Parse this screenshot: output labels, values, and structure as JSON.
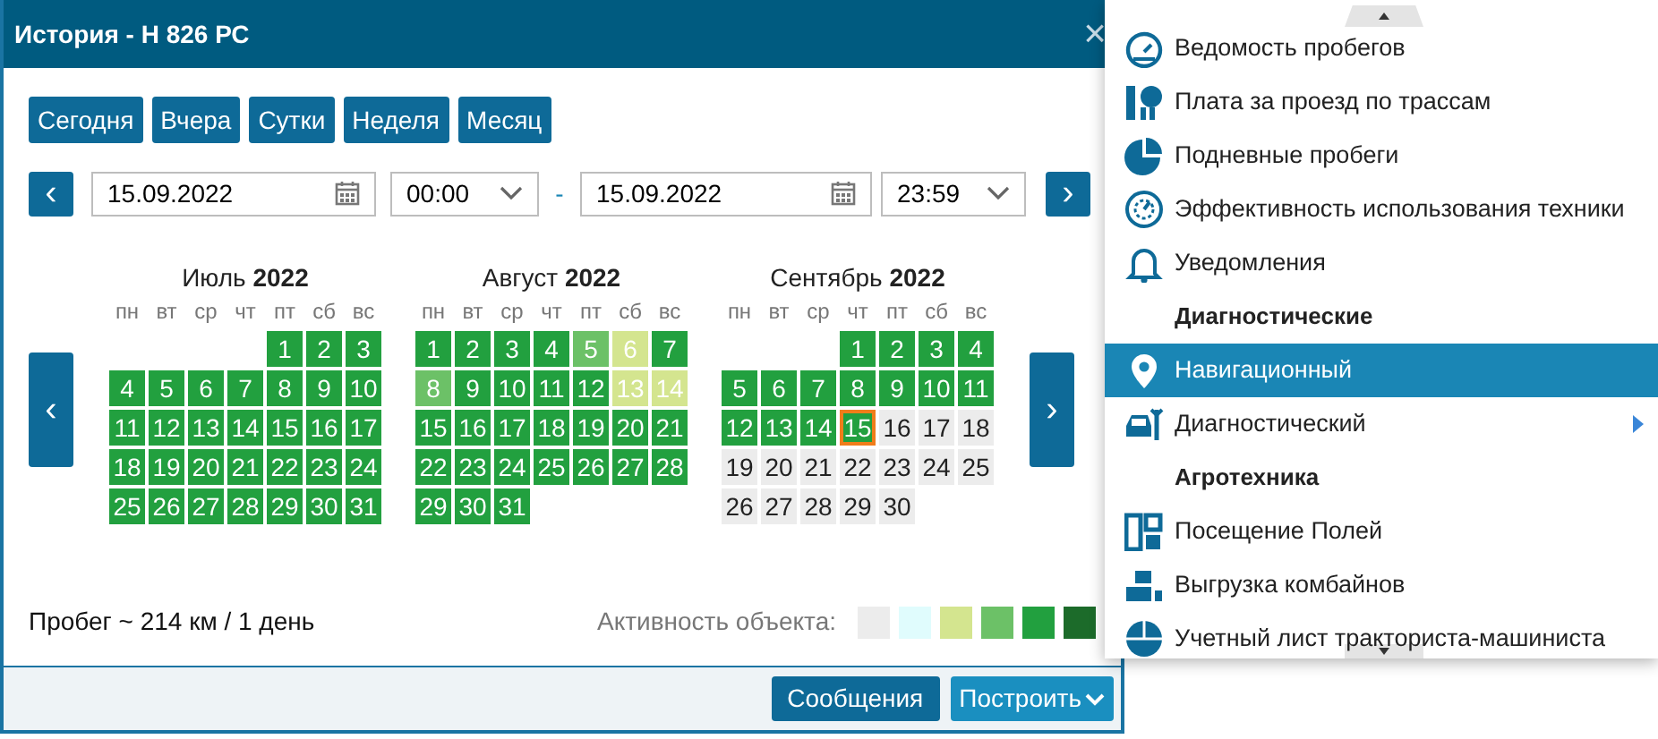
{
  "window": {
    "title": "История - Н 826 РС",
    "close": "×"
  },
  "quick_buttons": [
    "Сегодня",
    "Вчера",
    "Сутки",
    "Неделя",
    "Месяц"
  ],
  "range": {
    "prev": "‹",
    "from_date": "15.09.2022",
    "from_time": "00:00",
    "separator": "-",
    "to_date": "15.09.2022",
    "to_time": "23:59",
    "next": "›"
  },
  "calendar": {
    "prev": "‹",
    "next": "›",
    "months": [
      {
        "name": "Июль",
        "year": "2022",
        "weekdays": [
          "пн",
          "вт",
          "ср",
          "чт",
          "пт",
          "сб",
          "вс"
        ],
        "weeks": [
          [
            {
              "kind": "blank"
            },
            {
              "kind": "blank"
            },
            {
              "kind": "blank"
            },
            {
              "kind": "blank"
            },
            {
              "kind": "day",
              "day": "1",
              "color": "#22a03f",
              "selected": false
            },
            {
              "kind": "day",
              "day": "2",
              "color": "#22a03f",
              "selected": false
            },
            {
              "kind": "day",
              "day": "3",
              "color": "#22a03f",
              "selected": false
            }
          ],
          [
            {
              "kind": "day",
              "day": "4",
              "color": "#22a03f",
              "selected": false
            },
            {
              "kind": "day",
              "day": "5",
              "color": "#22a03f",
              "selected": false
            },
            {
              "kind": "day",
              "day": "6",
              "color": "#22a03f",
              "selected": false
            },
            {
              "kind": "day",
              "day": "7",
              "color": "#22a03f",
              "selected": false
            },
            {
              "kind": "day",
              "day": "8",
              "color": "#22a03f",
              "selected": false
            },
            {
              "kind": "day",
              "day": "9",
              "color": "#22a03f",
              "selected": false
            },
            {
              "kind": "day",
              "day": "10",
              "color": "#22a03f",
              "selected": false
            }
          ],
          [
            {
              "kind": "day",
              "day": "11",
              "color": "#22a03f",
              "selected": false
            },
            {
              "kind": "day",
              "day": "12",
              "color": "#22a03f",
              "selected": false
            },
            {
              "kind": "day",
              "day": "13",
              "color": "#22a03f",
              "selected": false
            },
            {
              "kind": "day",
              "day": "14",
              "color": "#22a03f",
              "selected": false
            },
            {
              "kind": "day",
              "day": "15",
              "color": "#22a03f",
              "selected": false
            },
            {
              "kind": "day",
              "day": "16",
              "color": "#22a03f",
              "selected": false
            },
            {
              "kind": "day",
              "day": "17",
              "color": "#22a03f",
              "selected": false
            }
          ],
          [
            {
              "kind": "day",
              "day": "18",
              "color": "#22a03f",
              "selected": false
            },
            {
              "kind": "day",
              "day": "19",
              "color": "#22a03f",
              "selected": false
            },
            {
              "kind": "day",
              "day": "20",
              "color": "#22a03f",
              "selected": false
            },
            {
              "kind": "day",
              "day": "21",
              "color": "#22a03f",
              "selected": false
            },
            {
              "kind": "day",
              "day": "22",
              "color": "#22a03f",
              "selected": false
            },
            {
              "kind": "day",
              "day": "23",
              "color": "#22a03f",
              "selected": false
            },
            {
              "kind": "day",
              "day": "24",
              "color": "#22a03f",
              "selected": false
            }
          ],
          [
            {
              "kind": "day",
              "day": "25",
              "color": "#22a03f",
              "selected": false
            },
            {
              "kind": "day",
              "day": "26",
              "color": "#22a03f",
              "selected": false
            },
            {
              "kind": "day",
              "day": "27",
              "color": "#22a03f",
              "selected": false
            },
            {
              "kind": "day",
              "day": "28",
              "color": "#22a03f",
              "selected": false
            },
            {
              "kind": "day",
              "day": "29",
              "color": "#22a03f",
              "selected": false
            },
            {
              "kind": "day",
              "day": "30",
              "color": "#22a03f",
              "selected": false
            },
            {
              "kind": "day",
              "day": "31",
              "color": "#22a03f",
              "selected": false
            }
          ]
        ]
      },
      {
        "name": "Август",
        "year": "2022",
        "weekdays": [
          "пн",
          "вт",
          "ср",
          "чт",
          "пт",
          "сб",
          "вс"
        ],
        "weeks": [
          [
            {
              "kind": "day",
              "day": "1",
              "color": "#22a03f",
              "selected": false
            },
            {
              "kind": "day",
              "day": "2",
              "color": "#22a03f",
              "selected": false
            },
            {
              "kind": "day",
              "day": "3",
              "color": "#22a03f",
              "selected": false
            },
            {
              "kind": "day",
              "day": "4",
              "color": "#22a03f",
              "selected": false
            },
            {
              "kind": "day",
              "day": "5",
              "color": "#6cc167",
              "selected": false
            },
            {
              "kind": "day",
              "day": "6",
              "color": "#d4e58f",
              "selected": false
            },
            {
              "kind": "day",
              "day": "7",
              "color": "#22a03f",
              "selected": false
            }
          ],
          [
            {
              "kind": "day",
              "day": "8",
              "color": "#6cc167",
              "selected": false
            },
            {
              "kind": "day",
              "day": "9",
              "color": "#22a03f",
              "selected": false
            },
            {
              "kind": "day",
              "day": "10",
              "color": "#22a03f",
              "selected": false
            },
            {
              "kind": "day",
              "day": "11",
              "color": "#22a03f",
              "selected": false
            },
            {
              "kind": "day",
              "day": "12",
              "color": "#22a03f",
              "selected": false
            },
            {
              "kind": "day",
              "day": "13",
              "color": "#d4e58f",
              "selected": false
            },
            {
              "kind": "day",
              "day": "14",
              "color": "#d4e58f",
              "selected": false
            }
          ],
          [
            {
              "kind": "day",
              "day": "15",
              "color": "#22a03f",
              "selected": false
            },
            {
              "kind": "day",
              "day": "16",
              "color": "#22a03f",
              "selected": false
            },
            {
              "kind": "day",
              "day": "17",
              "color": "#22a03f",
              "selected": false
            },
            {
              "kind": "day",
              "day": "18",
              "color": "#22a03f",
              "selected": false
            },
            {
              "kind": "day",
              "day": "19",
              "color": "#22a03f",
              "selected": false
            },
            {
              "kind": "day",
              "day": "20",
              "color": "#22a03f",
              "selected": false
            },
            {
              "kind": "day",
              "day": "21",
              "color": "#22a03f",
              "selected": false
            }
          ],
          [
            {
              "kind": "day",
              "day": "22",
              "color": "#22a03f",
              "selected": false
            },
            {
              "kind": "day",
              "day": "23",
              "color": "#22a03f",
              "selected": false
            },
            {
              "kind": "day",
              "day": "24",
              "color": "#22a03f",
              "selected": false
            },
            {
              "kind": "day",
              "day": "25",
              "color": "#22a03f",
              "selected": false
            },
            {
              "kind": "day",
              "day": "26",
              "color": "#22a03f",
              "selected": false
            },
            {
              "kind": "day",
              "day": "27",
              "color": "#22a03f",
              "selected": false
            },
            {
              "kind": "day",
              "day": "28",
              "color": "#22a03f",
              "selected": false
            }
          ],
          [
            {
              "kind": "day",
              "day": "29",
              "color": "#22a03f",
              "selected": false
            },
            {
              "kind": "day",
              "day": "30",
              "color": "#22a03f",
              "selected": false
            },
            {
              "kind": "day",
              "day": "31",
              "color": "#22a03f",
              "selected": false
            }
          ]
        ]
      },
      {
        "name": "Сентябрь",
        "year": "2022",
        "weekdays": [
          "пн",
          "вт",
          "ср",
          "чт",
          "пт",
          "сб",
          "вс"
        ],
        "weeks": [
          [
            {
              "kind": "blank"
            },
            {
              "kind": "blank"
            },
            {
              "kind": "blank"
            },
            {
              "kind": "day",
              "day": "1",
              "color": "#22a03f",
              "selected": false
            },
            {
              "kind": "day",
              "day": "2",
              "color": "#22a03f",
              "selected": false
            },
            {
              "kind": "day",
              "day": "3",
              "color": "#22a03f",
              "selected": false
            },
            {
              "kind": "day",
              "day": "4",
              "color": "#22a03f",
              "selected": false
            }
          ],
          [
            {
              "kind": "day",
              "day": "5",
              "color": "#22a03f",
              "selected": false
            },
            {
              "kind": "day",
              "day": "6",
              "color": "#22a03f",
              "selected": false
            },
            {
              "kind": "day",
              "day": "7",
              "color": "#22a03f",
              "selected": false
            },
            {
              "kind": "day",
              "day": "8",
              "color": "#22a03f",
              "selected": false
            },
            {
              "kind": "day",
              "day": "9",
              "color": "#22a03f",
              "selected": false
            },
            {
              "kind": "day",
              "day": "10",
              "color": "#22a03f",
              "selected": false
            },
            {
              "kind": "day",
              "day": "11",
              "color": "#22a03f",
              "selected": false
            }
          ],
          [
            {
              "kind": "day",
              "day": "12",
              "color": "#22a03f",
              "selected": false
            },
            {
              "kind": "day",
              "day": "13",
              "color": "#22a03f",
              "selected": false
            },
            {
              "kind": "day",
              "day": "14",
              "color": "#22a03f",
              "selected": false
            },
            {
              "kind": "day",
              "day": "15",
              "color": "#22a03f",
              "selected": true
            },
            {
              "kind": "day",
              "day": "16",
              "color": "#ececec",
              "selected": false
            },
            {
              "kind": "day",
              "day": "17",
              "color": "#ececec",
              "selected": false
            },
            {
              "kind": "day",
              "day": "18",
              "color": "#ececec",
              "selected": false
            }
          ],
          [
            {
              "kind": "day",
              "day": "19",
              "color": "#ececec",
              "selected": false
            },
            {
              "kind": "day",
              "day": "20",
              "color": "#ececec",
              "selected": false
            },
            {
              "kind": "day",
              "day": "21",
              "color": "#ececec",
              "selected": false
            },
            {
              "kind": "day",
              "day": "22",
              "color": "#ececec",
              "selected": false
            },
            {
              "kind": "day",
              "day": "23",
              "color": "#ececec",
              "selected": false
            },
            {
              "kind": "day",
              "day": "24",
              "color": "#ececec",
              "selected": false
            },
            {
              "kind": "day",
              "day": "25",
              "color": "#ececec",
              "selected": false
            }
          ],
          [
            {
              "kind": "day",
              "day": "26",
              "color": "#ececec",
              "selected": false
            },
            {
              "kind": "day",
              "day": "27",
              "color": "#ececec",
              "selected": false
            },
            {
              "kind": "day",
              "day": "28",
              "color": "#ececec",
              "selected": false
            },
            {
              "kind": "day",
              "day": "29",
              "color": "#ececec",
              "selected": false
            },
            {
              "kind": "day",
              "day": "30",
              "color": "#ececec",
              "selected": false
            }
          ]
        ]
      }
    ]
  },
  "mileage": "Пробег ~ 214 км / 1 день",
  "activity_legend": {
    "label": "Активность объекта:",
    "swatches": [
      {
        "color": "#ececec"
      },
      {
        "color": "#e0fcfd"
      },
      {
        "color": "#d4e58f"
      },
      {
        "color": "#6cc167"
      },
      {
        "color": "#22a03f"
      },
      {
        "color": "#1c6b2a"
      }
    ]
  },
  "footer_buttons": [
    {
      "label": "Сообщения",
      "kind": "plain"
    },
    {
      "label": "Построить",
      "kind": "dropdown"
    }
  ],
  "menu": {
    "items": [
      {
        "kind": "item",
        "label": "Ведомость пробегов",
        "selected": false,
        "has_submenu": false
      },
      {
        "kind": "item",
        "label": "Плата за проезд по трассам",
        "selected": false,
        "has_submenu": false
      },
      {
        "kind": "item",
        "label": "Подневные пробеги",
        "selected": false,
        "has_submenu": false
      },
      {
        "kind": "item",
        "label": "Эффективность использования техники",
        "selected": false,
        "has_submenu": false
      },
      {
        "kind": "item",
        "label": "Уведомления",
        "selected": false,
        "has_submenu": false
      },
      {
        "kind": "header",
        "label": "Диагностические"
      },
      {
        "kind": "item",
        "label": "Навигационный",
        "selected": true,
        "has_submenu": false
      },
      {
        "kind": "item",
        "label": "Диагностический",
        "selected": false,
        "has_submenu": true
      },
      {
        "kind": "header",
        "label": "Агротехника"
      },
      {
        "kind": "item",
        "label": "Посещение Полей",
        "selected": false,
        "has_submenu": false
      },
      {
        "kind": "item",
        "label": "Выгрузка комбайнов",
        "selected": false,
        "has_submenu": false
      },
      {
        "kind": "item",
        "label": "Учетный лист тракториста-машиниста",
        "selected": false,
        "has_submenu": false
      }
    ]
  }
}
